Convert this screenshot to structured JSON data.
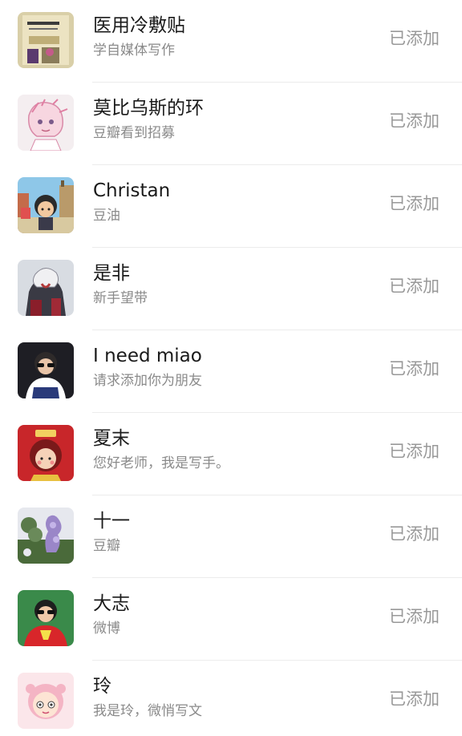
{
  "requests": [
    {
      "name": "医用冷敷贴",
      "message": "学自媒体写作",
      "status": "已添加",
      "avatar_icon": "book-cover-avatar"
    },
    {
      "name": "莫比乌斯的环",
      "message": "豆瓣看到招募",
      "status": "已添加",
      "avatar_icon": "anime-girl-sketch-avatar"
    },
    {
      "name": "Christan",
      "message": "豆油",
      "status": "已添加",
      "avatar_icon": "cartoon-boy-city-avatar"
    },
    {
      "name": "是非",
      "message": "新手望带",
      "status": "已添加",
      "avatar_icon": "dark-anime-character-avatar"
    },
    {
      "name": "I need miao",
      "message": "请求添加你为朋友",
      "status": "已添加",
      "avatar_icon": "sunglasses-person-avatar"
    },
    {
      "name": "夏末",
      "message": "您好老师，我是写手。",
      "status": "已添加",
      "avatar_icon": "red-cartoon-girl-avatar"
    },
    {
      "name": "十一",
      "message": "豆瓣",
      "status": "已添加",
      "avatar_icon": "purple-flowers-avatar"
    },
    {
      "name": "大志",
      "message": "微博",
      "status": "已添加",
      "avatar_icon": "cartoon-red-shirt-avatar"
    },
    {
      "name": "玲",
      "message": "我是玲，微悄写文",
      "status": "已添加",
      "avatar_icon": "pink-cartoon-face-avatar"
    }
  ]
}
